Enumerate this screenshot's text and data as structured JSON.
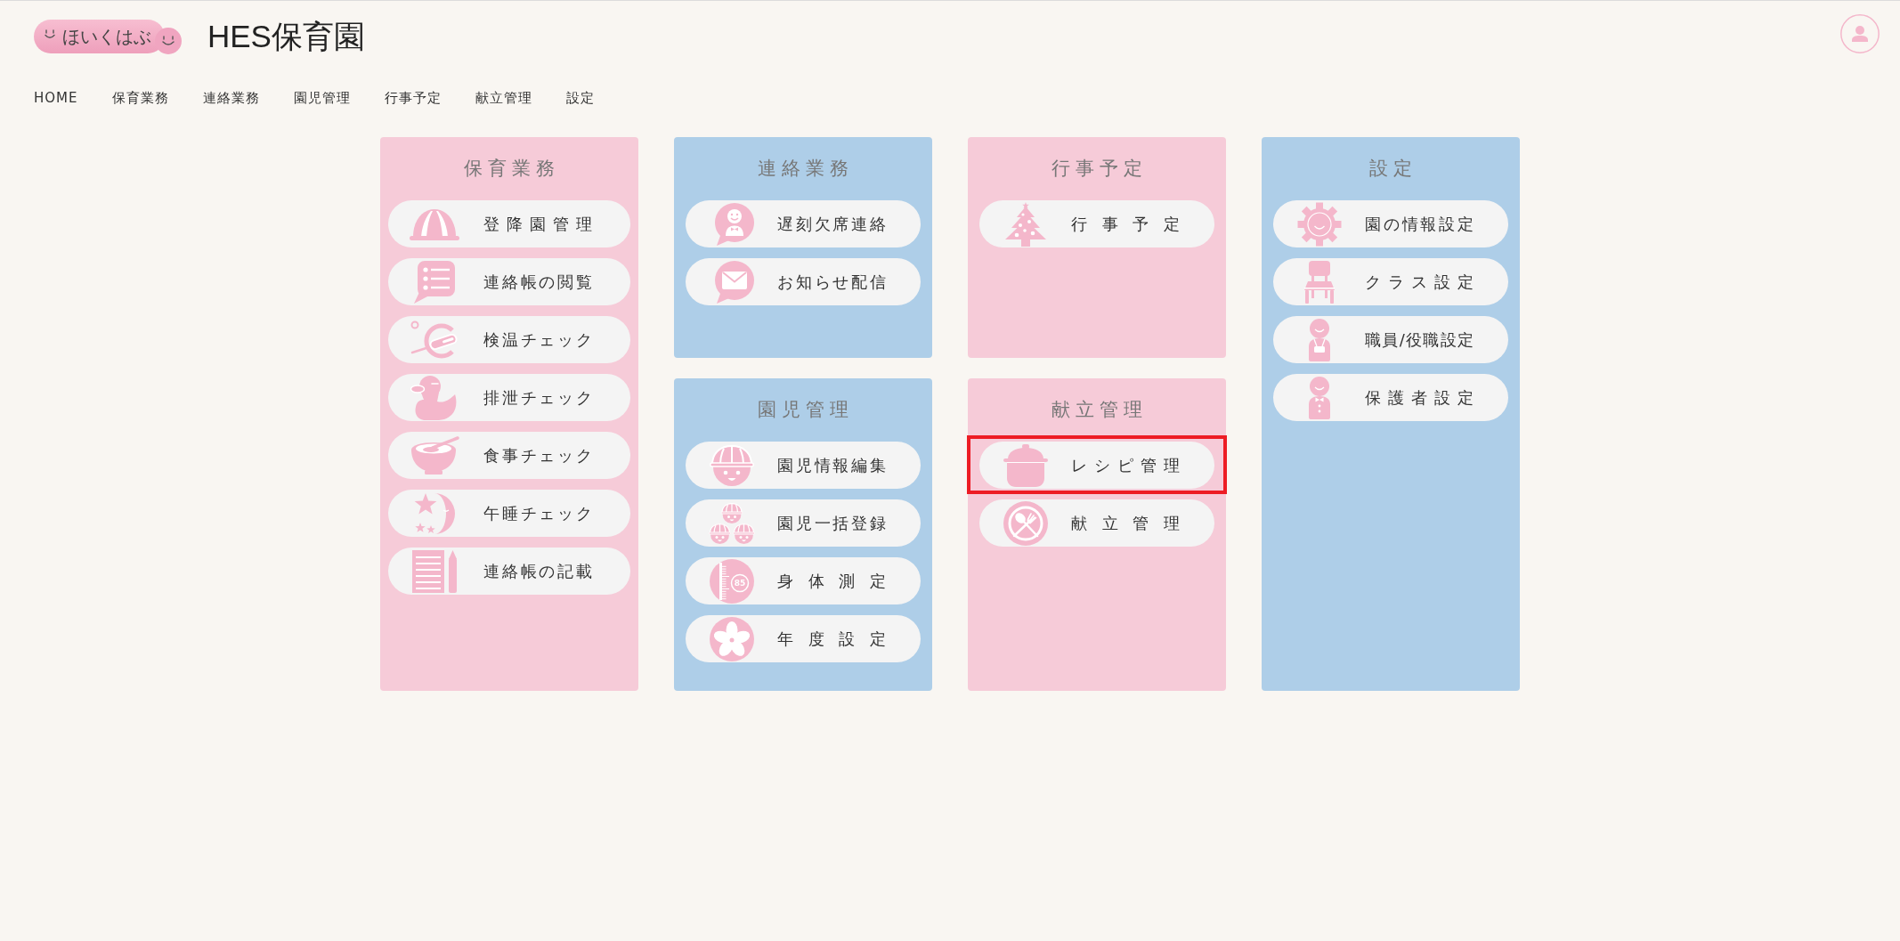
{
  "logo": {
    "text": "ほいくはぶ"
  },
  "site_title": "HES保育園",
  "nav": [
    "HOME",
    "保育業務",
    "連絡業務",
    "園児管理",
    "行事予定",
    "献立管理",
    "設定"
  ],
  "columns": [
    {
      "panels": [
        {
          "title": "保育業務",
          "color": "#f6cbd8",
          "items": [
            {
              "label": "登降園管理",
              "highlighted": false
            },
            {
              "label": "連絡帳の閲覧",
              "highlighted": false
            },
            {
              "label": "検温チェック",
              "highlighted": false
            },
            {
              "label": "排泄チェック",
              "highlighted": false
            },
            {
              "label": "食事チェック",
              "highlighted": false
            },
            {
              "label": "午睡チェック",
              "highlighted": false
            },
            {
              "label": "連絡帳の記載",
              "highlighted": false
            }
          ]
        }
      ]
    },
    {
      "panels": [
        {
          "title": "連絡業務",
          "color": "#aecee8",
          "items": [
            {
              "label": "遅刻欠席連絡",
              "highlighted": false
            },
            {
              "label": "お知らせ配信",
              "highlighted": false
            }
          ]
        },
        {
          "title": "園児管理",
          "color": "#aecee8",
          "items": [
            {
              "label": "園児情報編集",
              "highlighted": false
            },
            {
              "label": "園児一括登録",
              "highlighted": false
            },
            {
              "label": "身体測定",
              "icon_label": "85",
              "highlighted": false
            },
            {
              "label": "年度設定",
              "highlighted": false
            }
          ]
        }
      ]
    },
    {
      "panels": [
        {
          "title": "行事予定",
          "color": "#f6cbd8",
          "items": [
            {
              "label": "行事予定",
              "highlighted": false
            }
          ]
        },
        {
          "title": "献立管理",
          "color": "#f6cbd8",
          "items": [
            {
              "label": "レシピ管理",
              "highlighted": true
            },
            {
              "label": "献立管理",
              "highlighted": false
            }
          ]
        }
      ]
    },
    {
      "panels": [
        {
          "title": "設定",
          "color": "#aecee8",
          "items": [
            {
              "label": "園の情報設定",
              "highlighted": false
            },
            {
              "label": "クラス設定",
              "highlighted": false
            },
            {
              "label": "職員/役職設定",
              "highlighted": false
            },
            {
              "label": "保護者設定",
              "highlighted": false
            }
          ]
        }
      ]
    }
  ]
}
